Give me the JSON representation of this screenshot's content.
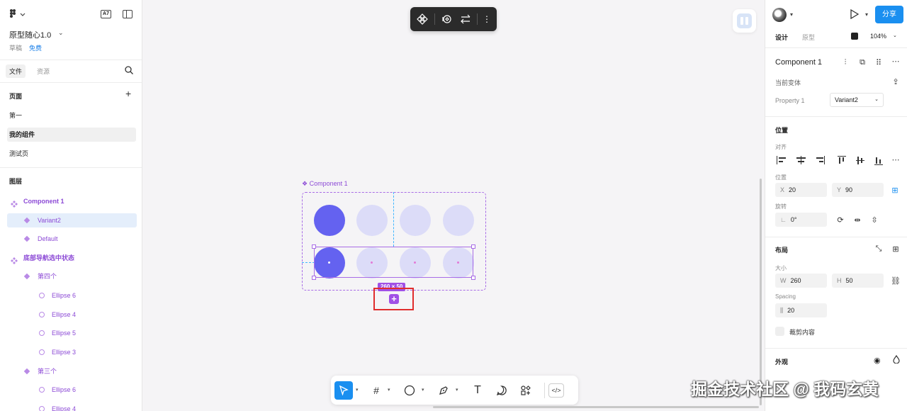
{
  "left": {
    "logo_icon": "figma-logo",
    "font_badge": "A7",
    "project_title": "原型随心1.0",
    "project_status": "草稿",
    "plan": "免费",
    "tabs": {
      "file": "文件",
      "assets": "资源"
    },
    "pages_title": "页面",
    "pages": [
      {
        "label": "第一",
        "selected": false
      },
      {
        "label": "我的组件",
        "selected": true
      },
      {
        "label": "测试页",
        "selected": false
      }
    ],
    "layers_title": "图层",
    "layers": [
      {
        "label": "Component 1",
        "icon": "component-set-icon",
        "depth": 0,
        "selected": false,
        "bold": true
      },
      {
        "label": "Variant2",
        "icon": "component-icon",
        "depth": 1,
        "selected": true,
        "bold": false
      },
      {
        "label": "Default",
        "icon": "component-icon",
        "depth": 1,
        "selected": false,
        "bold": false
      },
      {
        "label": "底部导航选中状态",
        "icon": "component-set-icon",
        "depth": 0,
        "selected": false,
        "bold": true
      },
      {
        "label": "第四个",
        "icon": "component-icon",
        "depth": 1,
        "selected": false,
        "bold": false
      },
      {
        "label": "Ellipse 6",
        "icon": "ellipse-icon",
        "depth": 2,
        "selected": false,
        "bold": false
      },
      {
        "label": "Ellipse 4",
        "icon": "ellipse-icon",
        "depth": 2,
        "selected": false,
        "bold": false
      },
      {
        "label": "Ellipse 5",
        "icon": "ellipse-icon",
        "depth": 2,
        "selected": false,
        "bold": false
      },
      {
        "label": "Ellipse 3",
        "icon": "ellipse-icon",
        "depth": 2,
        "selected": false,
        "bold": false
      },
      {
        "label": "第三个",
        "icon": "component-icon",
        "depth": 1,
        "selected": false,
        "bold": false
      },
      {
        "label": "Ellipse 6",
        "icon": "ellipse-icon",
        "depth": 2,
        "selected": false,
        "bold": false
      },
      {
        "label": "Ellipse 4",
        "icon": "ellipse-icon",
        "depth": 2,
        "selected": false,
        "bold": false
      }
    ]
  },
  "canvas": {
    "frame_label": "Component 1",
    "dimension_badge": "260 × 50",
    "add_variant_icon": "plus-icon",
    "top_toolbar_icons": [
      "component-icon",
      "swap-instance-icon",
      "arrows-swap-icon",
      "more-vertical-icon"
    ],
    "bottom_toolbar_icons": [
      "move-tool-icon",
      "frame-tool-icon",
      "ellipse-tool-icon",
      "pen-tool-icon",
      "text-tool-icon",
      "comment-icon",
      "assets-icon",
      "dev-mode-icon"
    ],
    "colors": {
      "active_circle": "#6462f0",
      "inactive_circle": "#dcdcf8",
      "component_purple": "#a050e6",
      "highlight_red": "#e02d2d"
    }
  },
  "right": {
    "share_label": "分享",
    "tabs": {
      "design": "设计",
      "prototype": "原型"
    },
    "zoom": "104%",
    "component_name": "Component 1",
    "current_variant_label": "当前变体",
    "property_name": "Property 1",
    "property_value": "Variant2",
    "position": {
      "title": "位置",
      "align_label": "对齐",
      "position_label": "位置",
      "x_prefix": "X",
      "x": "20",
      "y_prefix": "Y",
      "y": "90",
      "rotation_label": "旋转",
      "rotation": "0°"
    },
    "layout": {
      "title": "布局",
      "size_label": "大小",
      "w_prefix": "W",
      "w": "260",
      "h_prefix": "H",
      "h": "50",
      "spacing_label": "Spacing",
      "spacing": "20",
      "clip_label": "裁剪内容"
    },
    "appearance": {
      "title": "外观"
    }
  },
  "watermark": "掘金技术社区 @ 我码玄黄"
}
